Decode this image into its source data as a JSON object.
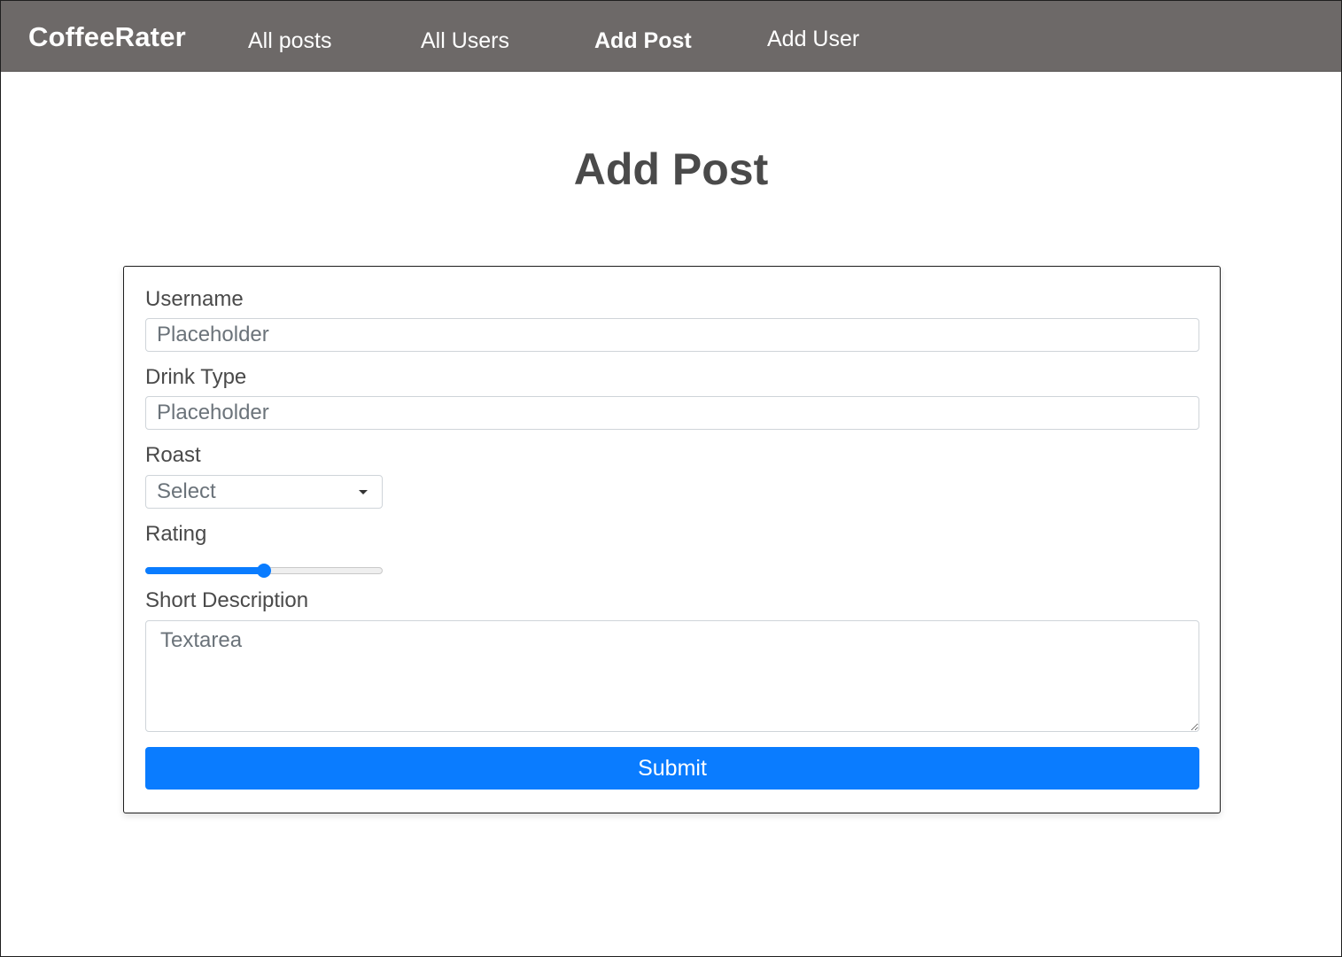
{
  "navbar": {
    "brand": "CoffeeRater",
    "links": [
      {
        "label": "All posts",
        "active": false
      },
      {
        "label": "All Users",
        "active": false
      },
      {
        "label": "Add Post",
        "active": true
      },
      {
        "label": "Add User",
        "active": false
      }
    ],
    "background_color": "#6d6968"
  },
  "page": {
    "title": "Add Post"
  },
  "form": {
    "username": {
      "label": "Username",
      "value": "",
      "placeholder": "Placeholder"
    },
    "drink_type": {
      "label": "Drink Type",
      "value": "",
      "placeholder": "Placeholder"
    },
    "roast": {
      "label": "Roast",
      "selected": "Select",
      "icon": "chevron-down-icon"
    },
    "rating": {
      "label": "Rating",
      "value": 0.5
    },
    "short_description": {
      "label": "Short Description",
      "value": "",
      "placeholder": "Textarea"
    },
    "submit_label": "Submit",
    "accent_color": "#0a7cff"
  }
}
